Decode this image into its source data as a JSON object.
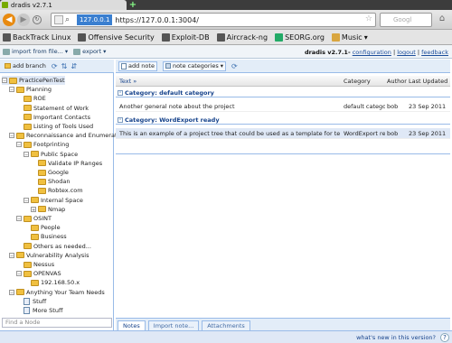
{
  "browser": {
    "tab_title": "dradis v2.7.1",
    "new_tab_label": "+",
    "url_host": "127.0.0.1",
    "url": "https://127.0.0.1:3004/",
    "search_placeholder": "Googl",
    "bookmarks": [
      {
        "label": "BackTrack Linux",
        "icon": "backtrack-icon"
      },
      {
        "label": "Offensive Security",
        "icon": "offsec-icon"
      },
      {
        "label": "Exploit-DB",
        "icon": "exploitdb-icon"
      },
      {
        "label": "Aircrack-ng",
        "icon": "aircrack-icon"
      },
      {
        "label": "SEORG.org",
        "icon": "seorg-icon"
      },
      {
        "label": "Music",
        "icon": "folder-icon"
      }
    ]
  },
  "app": {
    "import_label": "import from file...",
    "export_label": "export",
    "version_text": "dradis v2.7.1-",
    "links": [
      "configuration",
      "logout",
      "feedback"
    ],
    "separator": "|"
  },
  "tree": {
    "add_branch_label": "add branch",
    "find_placeholder": "Find a Node",
    "nodes": [
      {
        "label": "PracticePenTest",
        "depth": 0,
        "expand": "−",
        "type": "folder",
        "selected": true
      },
      {
        "label": "Planning",
        "depth": 1,
        "expand": "−",
        "type": "folder"
      },
      {
        "label": "ROE",
        "depth": 2,
        "expand": "",
        "type": "folder"
      },
      {
        "label": "Statement of Work",
        "depth": 2,
        "expand": "",
        "type": "folder"
      },
      {
        "label": "Important Contacts",
        "depth": 2,
        "expand": "",
        "type": "folder"
      },
      {
        "label": "Listing of Tools Used",
        "depth": 2,
        "expand": "",
        "type": "folder"
      },
      {
        "label": "Reconnaissance and Enumeration",
        "depth": 1,
        "expand": "−",
        "type": "folder"
      },
      {
        "label": "Footprinting",
        "depth": 2,
        "expand": "−",
        "type": "folder"
      },
      {
        "label": "Public Space",
        "depth": 3,
        "expand": "−",
        "type": "folder"
      },
      {
        "label": "Validate IP Ranges",
        "depth": 4,
        "expand": "",
        "type": "folder"
      },
      {
        "label": "Google",
        "depth": 4,
        "expand": "",
        "type": "folder"
      },
      {
        "label": "Shodan",
        "depth": 4,
        "expand": "",
        "type": "folder"
      },
      {
        "label": "Robtex.com",
        "depth": 4,
        "expand": "",
        "type": "folder"
      },
      {
        "label": "Internal Space",
        "depth": 3,
        "expand": "−",
        "type": "folder"
      },
      {
        "label": "Nmap",
        "depth": 4,
        "expand": "+",
        "type": "folder"
      },
      {
        "label": "OSINT",
        "depth": 2,
        "expand": "−",
        "type": "folder"
      },
      {
        "label": "People",
        "depth": 3,
        "expand": "",
        "type": "folder"
      },
      {
        "label": "Business",
        "depth": 3,
        "expand": "",
        "type": "folder"
      },
      {
        "label": "Others as needed...",
        "depth": 2,
        "expand": "",
        "type": "folder"
      },
      {
        "label": "Vulnerability Analysis",
        "depth": 1,
        "expand": "−",
        "type": "folder"
      },
      {
        "label": "Nessus",
        "depth": 2,
        "expand": "",
        "type": "folder"
      },
      {
        "label": "OPENVAS",
        "depth": 2,
        "expand": "−",
        "type": "folder"
      },
      {
        "label": "192.168.50.x",
        "depth": 3,
        "expand": "",
        "type": "folder"
      },
      {
        "label": "Anything Your Team Needs",
        "depth": 1,
        "expand": "−",
        "type": "folder"
      },
      {
        "label": "Stuff",
        "depth": 2,
        "expand": "",
        "type": "doc"
      },
      {
        "label": "More Stuff",
        "depth": 2,
        "expand": "",
        "type": "doc"
      }
    ]
  },
  "notes": {
    "add_note_label": "add note",
    "categories_label": "note categories",
    "columns": {
      "text": "Text »",
      "category": "Category",
      "author": "Author",
      "updated": "Last Updated"
    },
    "groups": [
      {
        "title": "Category: default category",
        "rows": [
          {
            "text": "Another general note about the project",
            "category": "default category",
            "author": "bob",
            "updated": "23 Sep 2011"
          }
        ]
      },
      {
        "title": "Category: WordExport ready",
        "rows": [
          {
            "text": "This is an example of a project tree that could be used as a template for testing. The goal w",
            "category": "WordExport read",
            "author": "bob",
            "updated": "23 Sep 2011"
          }
        ]
      }
    ],
    "tabs": [
      "Notes",
      "Import note...",
      "Attachments"
    ]
  },
  "status": {
    "text": "what's new in this version?",
    "help_glyph": "?"
  }
}
